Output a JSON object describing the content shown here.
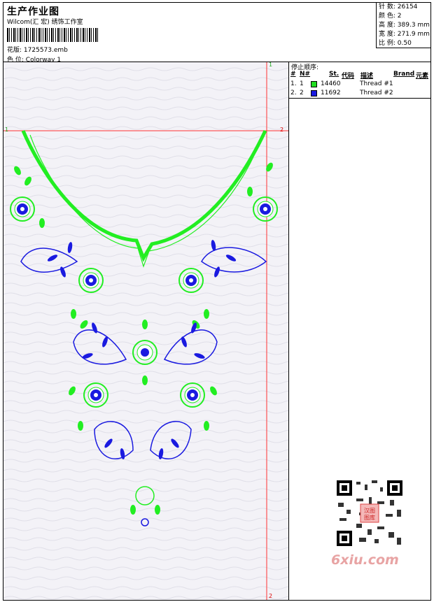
{
  "header": {
    "title": "生产作业图",
    "subtitle": "Wilcom(汇 宏) 绣饰工作室",
    "design_label": "花版:",
    "design_file": "1725573.emb",
    "colorway_label": "色 位:",
    "colorway": "Colorway 1"
  },
  "stats": [
    {
      "label": "针 数:",
      "value": "26154"
    },
    {
      "label": "颜 色:",
      "value": "2"
    },
    {
      "label": "高 度:",
      "value": "389.3 mm"
    },
    {
      "label": "宽 度:",
      "value": "271.9 mm"
    },
    {
      "label": "比 例:",
      "value": "0.50"
    }
  ],
  "legend": {
    "title": "停止顺序:",
    "headers": [
      "#",
      "N#",
      "St.",
      "代码",
      "描述",
      "Brand",
      "元素"
    ],
    "rows": [
      {
        "index": "1.",
        "n": "1",
        "color": "#22dd22",
        "code": "14460",
        "description": "Thread #1"
      },
      {
        "index": "2.",
        "n": "2",
        "color": "#1a1ae0",
        "code": "11692",
        "description": "Thread #2"
      }
    ]
  },
  "markers": {
    "one": "1",
    "two": "2"
  },
  "watermark": "6xiu.com",
  "qr_badge": "汉图\n图库"
}
